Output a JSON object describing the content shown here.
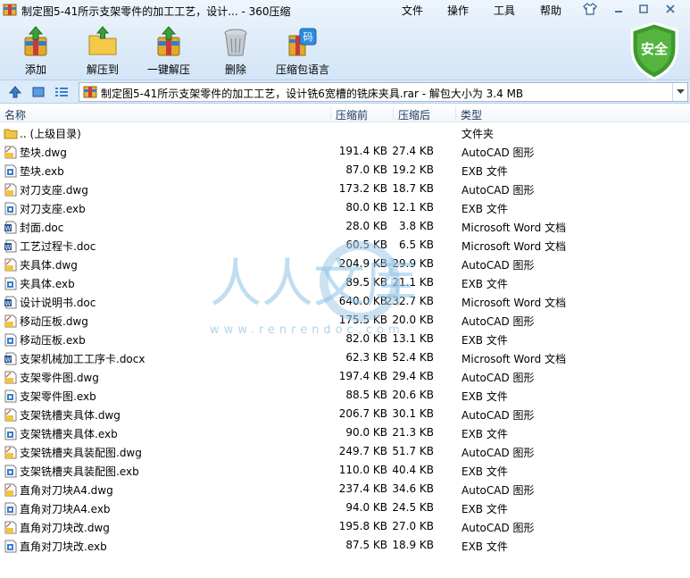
{
  "window": {
    "title": "制定图5-41所示支架零件的加工工艺，设计... - 360压缩",
    "menu": [
      "文件",
      "操作",
      "工具",
      "帮助"
    ]
  },
  "toolbar": [
    {
      "label": "添加",
      "icon": "add-archive-icon"
    },
    {
      "label": "解压到",
      "icon": "extract-folder-icon"
    },
    {
      "label": "一键解压",
      "icon": "one-click-extract-icon"
    },
    {
      "label": "删除",
      "icon": "trash-can-icon"
    },
    {
      "label": "压缩包语言",
      "icon": "archive-language-icon"
    }
  ],
  "security": {
    "label": "安全"
  },
  "address": {
    "text": "制定图5-41所示支架零件的加工工艺，设计铣6宽槽的铣床夹具.rar - 解包大小为 3.4 MB"
  },
  "columns": {
    "name": "名称",
    "size": "压缩前",
    "compressed": "压缩后",
    "type": "类型"
  },
  "files": [
    {
      "name": ".. (上级目录)",
      "size": "",
      "compressed": "",
      "type": "文件夹",
      "icon": "parent-folder-icon"
    },
    {
      "name": "垫块.dwg",
      "size": "191.4 KB",
      "compressed": "27.4 KB",
      "type": "AutoCAD 图形",
      "icon": "dwg-file-icon"
    },
    {
      "name": "垫块.exb",
      "size": "87.0 KB",
      "compressed": "19.2 KB",
      "type": "EXB 文件",
      "icon": "exb-file-icon"
    },
    {
      "name": "对刀支座.dwg",
      "size": "173.2 KB",
      "compressed": "18.7 KB",
      "type": "AutoCAD 图形",
      "icon": "dwg-file-icon"
    },
    {
      "name": "对刀支座.exb",
      "size": "80.0 KB",
      "compressed": "12.1 KB",
      "type": "EXB 文件",
      "icon": "exb-file-icon"
    },
    {
      "name": "封面.doc",
      "size": "28.0 KB",
      "compressed": "3.8 KB",
      "type": "Microsoft Word 文档",
      "icon": "word-file-icon"
    },
    {
      "name": "工艺过程卡.doc",
      "size": "60.5 KB",
      "compressed": "6.5 KB",
      "type": "Microsoft Word 文档",
      "icon": "word-file-icon"
    },
    {
      "name": "夹具体.dwg",
      "size": "204.9 KB",
      "compressed": "29.9 KB",
      "type": "AutoCAD 图形",
      "icon": "dwg-file-icon"
    },
    {
      "name": "夹具体.exb",
      "size": "89.5 KB",
      "compressed": "21.1 KB",
      "type": "EXB 文件",
      "icon": "exb-file-icon"
    },
    {
      "name": "设计说明书.doc",
      "size": "640.0 KB",
      "compressed": "232.7 KB",
      "type": "Microsoft Word 文档",
      "icon": "word-file-icon"
    },
    {
      "name": "移动压板.dwg",
      "size": "175.5 KB",
      "compressed": "20.0 KB",
      "type": "AutoCAD 图形",
      "icon": "dwg-file-icon"
    },
    {
      "name": "移动压板.exb",
      "size": "82.0 KB",
      "compressed": "13.1 KB",
      "type": "EXB 文件",
      "icon": "exb-file-icon"
    },
    {
      "name": "支架机械加工工序卡.docx",
      "size": "62.3 KB",
      "compressed": "52.4 KB",
      "type": "Microsoft Word 文档",
      "icon": "word-file-icon"
    },
    {
      "name": "支架零件图.dwg",
      "size": "197.4 KB",
      "compressed": "29.4 KB",
      "type": "AutoCAD 图形",
      "icon": "dwg-file-icon"
    },
    {
      "name": "支架零件图.exb",
      "size": "88.5 KB",
      "compressed": "20.6 KB",
      "type": "EXB 文件",
      "icon": "exb-file-icon"
    },
    {
      "name": "支架铣槽夹具体.dwg",
      "size": "206.7 KB",
      "compressed": "30.1 KB",
      "type": "AutoCAD 图形",
      "icon": "dwg-file-icon"
    },
    {
      "name": "支架铣槽夹具体.exb",
      "size": "90.0 KB",
      "compressed": "21.3 KB",
      "type": "EXB 文件",
      "icon": "exb-file-icon"
    },
    {
      "name": "支架铣槽夹具装配图.dwg",
      "size": "249.7 KB",
      "compressed": "51.7 KB",
      "type": "AutoCAD 图形",
      "icon": "dwg-file-icon"
    },
    {
      "name": "支架铣槽夹具装配图.exb",
      "size": "110.0 KB",
      "compressed": "40.4 KB",
      "type": "EXB 文件",
      "icon": "exb-file-icon"
    },
    {
      "name": "直角对刀块A4.dwg",
      "size": "237.4 KB",
      "compressed": "34.6 KB",
      "type": "AutoCAD 图形",
      "icon": "dwg-file-icon"
    },
    {
      "name": "直角对刀块A4.exb",
      "size": "94.0 KB",
      "compressed": "24.5 KB",
      "type": "EXB 文件",
      "icon": "exb-file-icon"
    },
    {
      "name": "直角对刀块改.dwg",
      "size": "195.8 KB",
      "compressed": "27.0 KB",
      "type": "AutoCAD 图形",
      "icon": "dwg-file-icon"
    },
    {
      "name": "直角对刀块改.exb",
      "size": "87.5 KB",
      "compressed": "18.9 KB",
      "type": "EXB 文件",
      "icon": "exb-file-icon"
    }
  ],
  "watermark": {
    "text": "人人文库",
    "url": "www.renrendoc.com"
  },
  "colors": {
    "accent": "#2f6fbf",
    "shield": "#3c9a2d",
    "folder": "#f1c443"
  }
}
